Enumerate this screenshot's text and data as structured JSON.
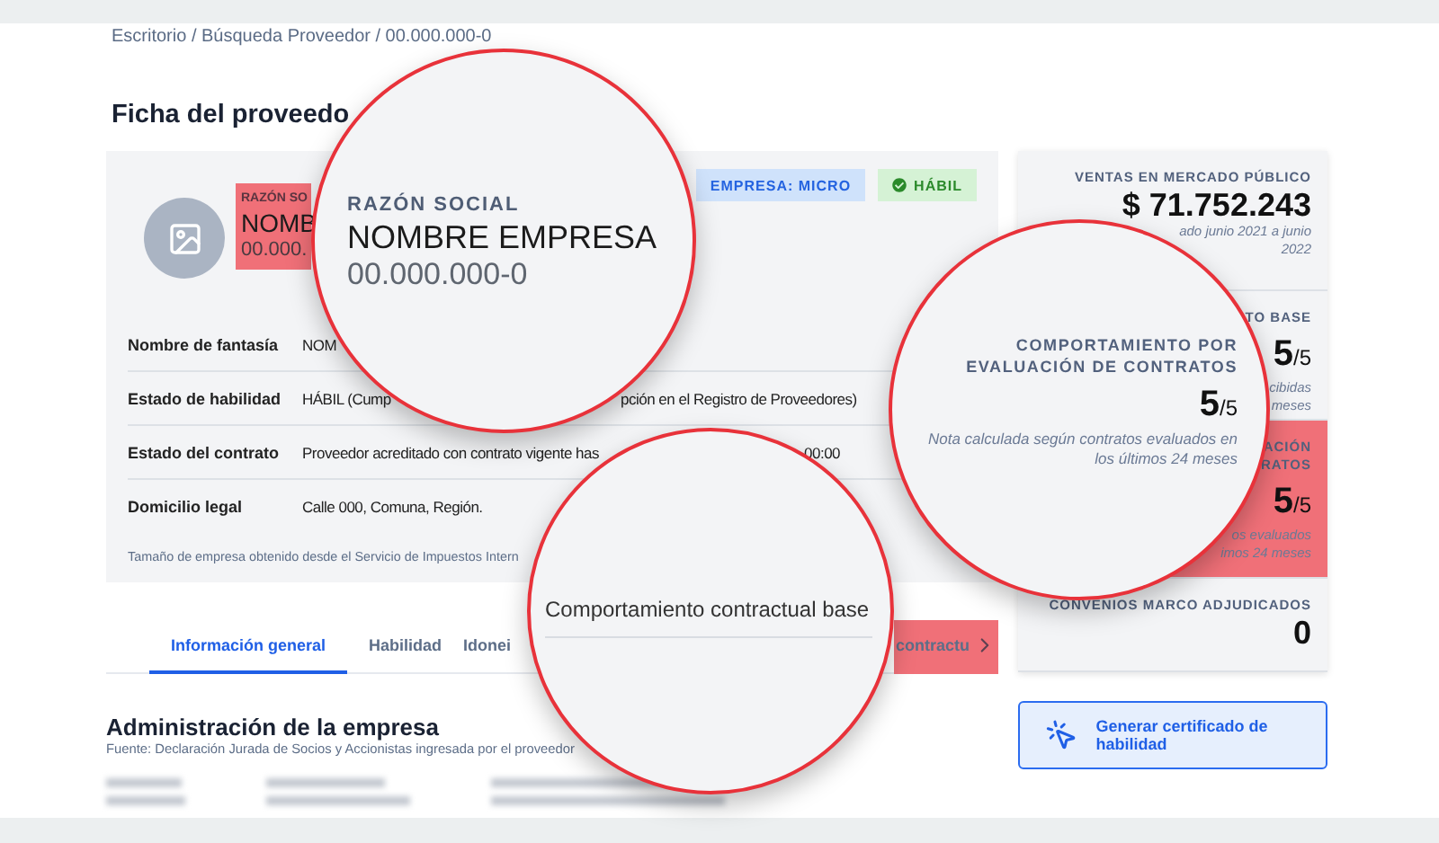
{
  "breadcrumb": "Escritorio / Búsqueda Proveedor / 00.000.000-0",
  "page_title": "Ficha del proveedo",
  "company": {
    "label": "RAZÓN SO",
    "name": "NOMB",
    "rut": "00.000.",
    "highlighted": true
  },
  "badges": [
    {
      "label": "EMPRESA: MICRO",
      "kind": "size"
    },
    {
      "label": "HÁBIL",
      "kind": "status"
    }
  ],
  "details": [
    {
      "label": "Nombre de fantasía",
      "value": [
        "NOM"
      ]
    },
    {
      "label": "Estado de habilidad",
      "value": [
        "HÁBIL (Cump",
        "pción en el Registro de Proveedores)"
      ]
    },
    {
      "label": "Estado del contrato",
      "value": [
        "Proveedor acreditado con contrato vigente has",
        "00:00"
      ]
    },
    {
      "label": "Domicilio legal",
      "value": [
        "Calle 000, Comuna, Región."
      ]
    }
  ],
  "footnote": "Tamaño de empresa obtenido desde el Servicio de Impuestos Intern",
  "tabs": [
    {
      "label": "Información general",
      "selected": true,
      "highlighted": false
    },
    {
      "label": "Habilidad",
      "selected": false,
      "highlighted": false
    },
    {
      "label": "Idonei",
      "selected": false,
      "highlighted": false
    },
    {
      "label": "contractu",
      "selected": false,
      "highlighted": true
    }
  ],
  "section": {
    "title": "Administración de la empresa",
    "source": "Fuente: Declaración Jurada de Socios y Accionistas ingresada por el proveedor"
  },
  "stats": [
    {
      "label": "VENTAS EN MERCADO PÚBLICO",
      "value": "$ 71.752.243",
      "note": [
        "ado junio 2021 a junio",
        "2022"
      ],
      "highlighted": false
    },
    {
      "label": "TO BASE",
      "score": "5",
      "max": "/5",
      "note": [
        "cibidas",
        "meses"
      ],
      "highlighted": false
    },
    {
      "label": "ACIÓN\nRATOS",
      "score": "5",
      "max": "/5",
      "note": [
        "os evaluados",
        "imos 24 meses"
      ],
      "highlighted": true
    },
    {
      "label": "CONVENIOS MARCO ADJUDICADOS",
      "value": "0",
      "highlighted": false
    }
  ],
  "certificate_button": "Generar certificado de habilidad",
  "magnifiers": [
    {
      "kind": "company",
      "label": "RAZÓN SOCIAL",
      "name": "NOMBRE EMPRESA",
      "rut": "00.000.000-0"
    },
    {
      "kind": "score",
      "title": "COMPORTAMIENTO POR EVALUACIÓN DE CONTRATOS",
      "score": "5",
      "max": "/5",
      "note": "Nota calculada según contratos evaluados en los últimos 24 meses"
    },
    {
      "kind": "tab",
      "label": "Comportamiento contractual base"
    }
  ]
}
